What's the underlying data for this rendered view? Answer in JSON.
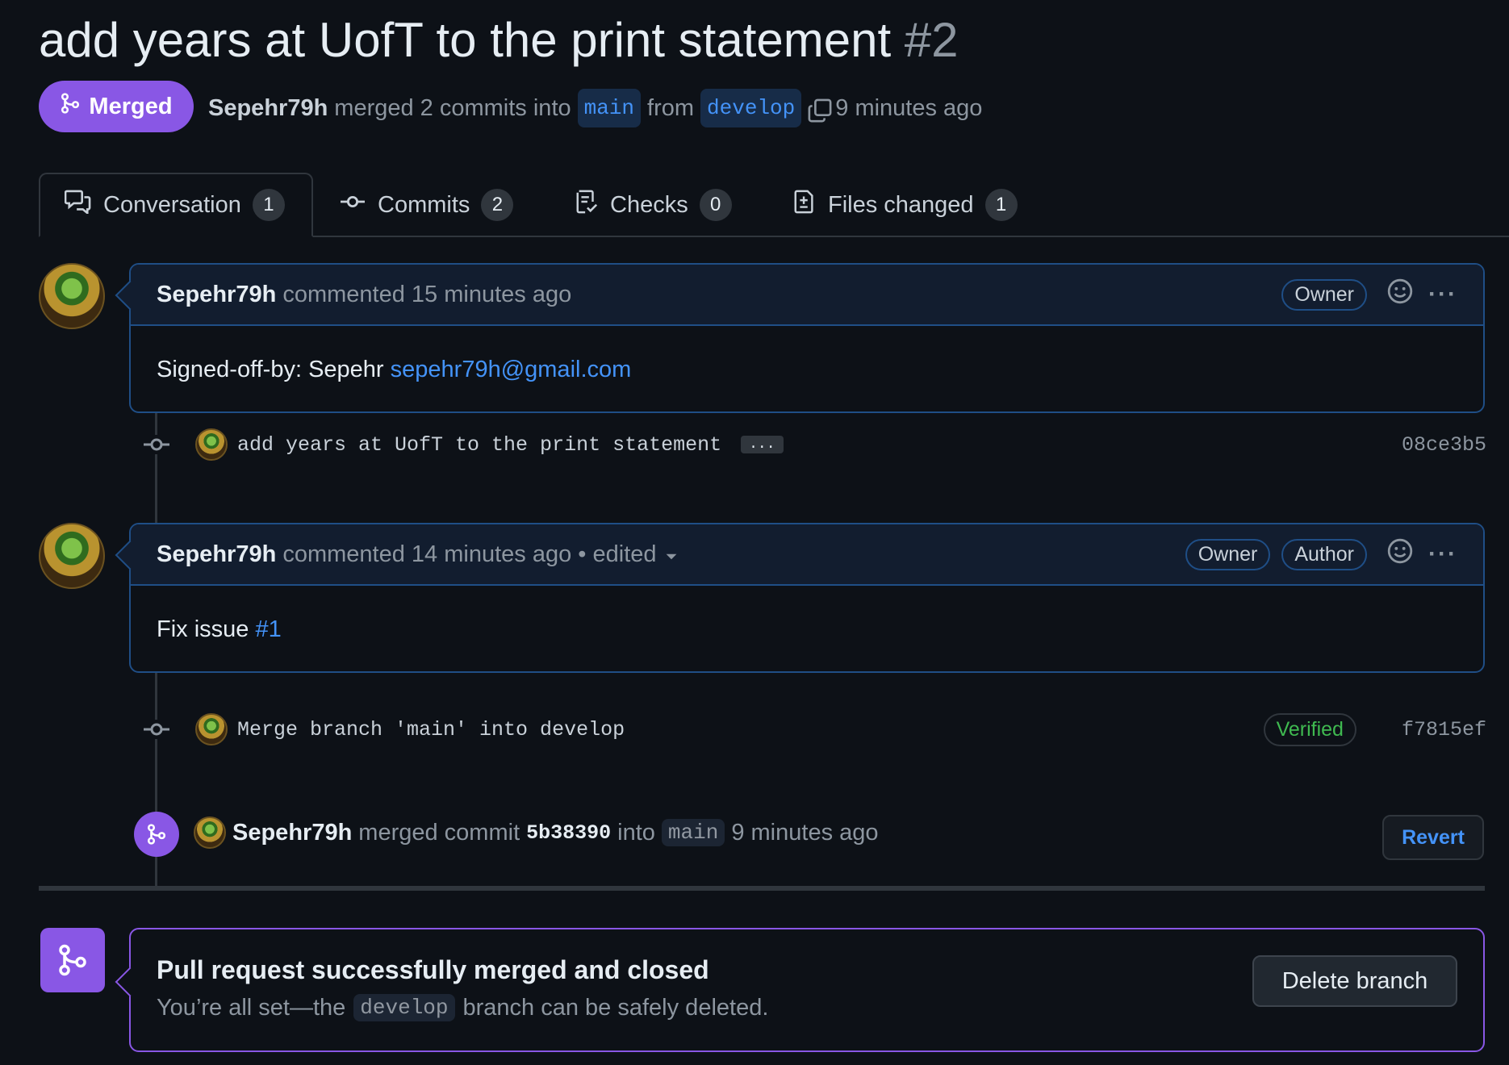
{
  "title": {
    "text": "add years at UofT to the print statement",
    "number": "#2"
  },
  "status": {
    "label": "Merged",
    "color": "#8957e5"
  },
  "meta": {
    "author": "Sepehr79h",
    "action": "merged 2 commits into",
    "base_branch": "main",
    "from": "from",
    "head_branch": "develop",
    "time": "9 minutes ago"
  },
  "tabs": [
    {
      "label": "Conversation",
      "count": "1",
      "icon": "comment-discussion-icon"
    },
    {
      "label": "Commits",
      "count": "2",
      "icon": "git-commit-icon"
    },
    {
      "label": "Checks",
      "count": "0",
      "icon": "checklist-icon"
    },
    {
      "label": "Files changed",
      "count": "1",
      "icon": "file-diff-icon"
    }
  ],
  "comments": [
    {
      "author": "Sepehr79h",
      "meta": "commented 15 minutes ago",
      "labels": [
        "Owner"
      ],
      "body_prefix": "Signed-off-by: Sepehr ",
      "body_link": "sepehr79h@gmail.com"
    },
    {
      "author": "Sepehr79h",
      "meta": "commented 14 minutes ago",
      "edited": "• edited",
      "labels": [
        "Owner",
        "Author"
      ],
      "body_prefix": "Fix issue ",
      "body_link": "#1"
    }
  ],
  "commits": [
    {
      "message": "add years at UofT to the print statement",
      "more": "...",
      "sha": "08ce3b5"
    },
    {
      "message": "Merge branch 'main' into develop",
      "verified": "Verified",
      "sha": "f7815ef"
    }
  ],
  "merge_event": {
    "author": "Sepehr79h",
    "action": "merged commit",
    "commit": "5b38390",
    "into": "into",
    "branch": "main",
    "time": "9 minutes ago",
    "revert_label": "Revert"
  },
  "merged_box": {
    "title": "Pull request successfully merged and closed",
    "sub_prefix": "You’re all set—the",
    "branch": "develop",
    "sub_suffix": "branch can be safely deleted.",
    "delete_label": "Delete branch"
  }
}
